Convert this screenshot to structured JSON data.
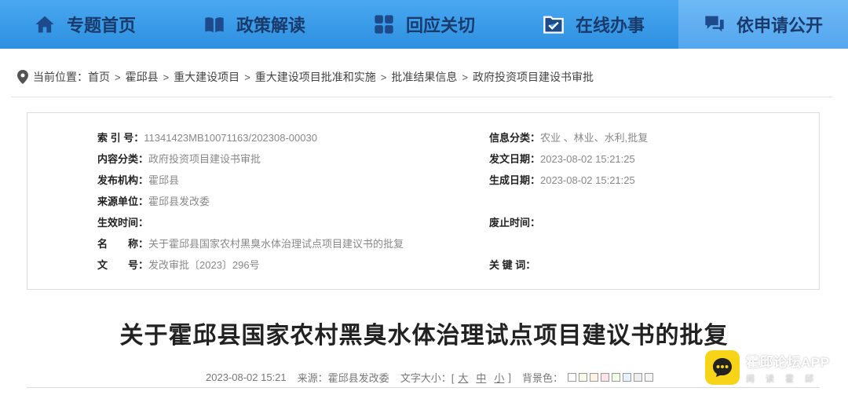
{
  "nav": {
    "items": [
      {
        "label": "专题首页",
        "icon": "home-icon"
      },
      {
        "label": "政策解读",
        "icon": "book-icon"
      },
      {
        "label": "回应关切",
        "icon": "grid-icon"
      },
      {
        "label": "在线办事",
        "icon": "folder-check-icon"
      },
      {
        "label": "依申请公开",
        "icon": "chat-icon"
      }
    ]
  },
  "breadcrumb": {
    "prefix": "当前位置：",
    "items": [
      "首页",
      "霍邱县",
      "重大建设项目",
      "重大建设项目批准和实施",
      "批准结果信息",
      "政府投资项目建设书审批"
    ],
    "separator": ">"
  },
  "info": {
    "index_no": {
      "label": "索 引 号：",
      "value": "11341423MB10071163/202308-00030"
    },
    "category": {
      "label": "信息分类：",
      "value": "农业 、林业、水利,批复"
    },
    "content_type": {
      "label": "内容分类：",
      "value": "政府投资项目建设书审批"
    },
    "issue_date": {
      "label": "发文日期：",
      "value": "2023-08-02 15:21:25"
    },
    "publisher": {
      "label": "发布机构：",
      "value": "霍邱县"
    },
    "gen_date": {
      "label": "生成日期：",
      "value": "2023-08-02 15:21:25"
    },
    "source": {
      "label": "来源单位：",
      "value": "霍邱县发改委"
    },
    "effective": {
      "label": "生效时间：",
      "value": ""
    },
    "abolish": {
      "label": "废止时间：",
      "value": ""
    },
    "name": {
      "label": "名　　称：",
      "value": "关于霍邱县国家农村黑臭水体治理试点项目建议书的批复"
    },
    "doc_no": {
      "label": "文　　号：",
      "value": "发改审批〔2023〕296号"
    },
    "keywords": {
      "label": "关 键 词：",
      "value": ""
    }
  },
  "article": {
    "title": "关于霍邱县国家农村黑臭水体治理试点项目建议书的批复",
    "date": "2023-08-02 15:21",
    "source_label": "来源：",
    "source": "霍邱县发改委",
    "font_size_label": "文字大小：[",
    "font_size_end": "]",
    "font_sizes": [
      "大",
      "中",
      "小"
    ],
    "bg_label": "背景色：",
    "bg_colors": [
      "#ffffff",
      "#fafbe6",
      "#fff2e2",
      "#ffe3e8",
      "#f1ffe3",
      "#e3f3ff",
      "#eeeeee",
      "#f5f5f5"
    ]
  },
  "watermark": {
    "title": "霍邱论坛APP",
    "subtitle": "阅读霍邱"
  }
}
